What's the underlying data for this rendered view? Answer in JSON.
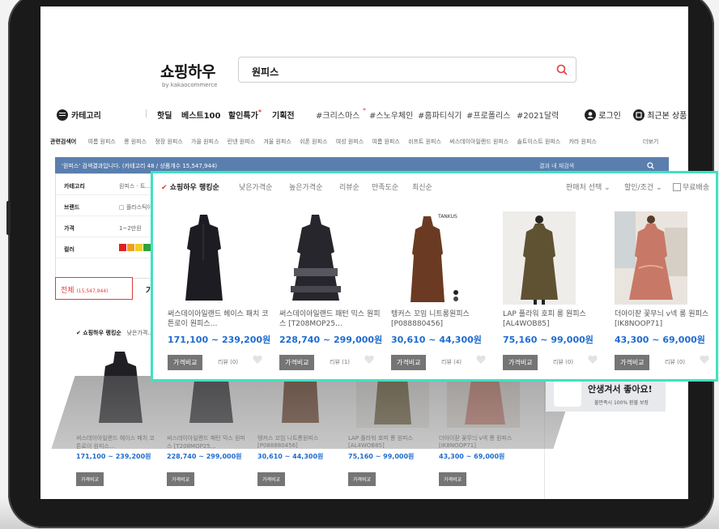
{
  "logo": {
    "title": "쇼핑하우",
    "sub": "by kakaocommerce"
  },
  "search": {
    "value": "원피스"
  },
  "nav": {
    "category": "카테고리",
    "items": [
      "핫딜",
      "베스트100",
      "할인특가",
      "기획전"
    ],
    "tags": [
      "#크리스마스",
      "#스노우체인",
      "#홈파티식기",
      "#프로폴리스",
      "#2021달력"
    ],
    "login": "로그인",
    "recent": "최근본 상품"
  },
  "related": {
    "label": "관련검색어",
    "keywords": [
      "여름 원피스",
      "롱 원피스",
      "정장 원피스",
      "가을 원피스",
      "린넨 원피스",
      "겨울 원피스",
      "쉬폰 원피스",
      "여성 원피스",
      "여름 원피스",
      "쉬프트 원피스",
      "써스데이아일랜드 원피스",
      "솔트이스트 원피스",
      "카라 원피스"
    ],
    "more": "더보기"
  },
  "infobar": {
    "text": "'원피스' 검색결과입니다. (카테고리 48 / 상품개수 15,547,944)",
    "inner": "결과 내 재검색"
  },
  "filters": [
    {
      "key": "카테고리",
      "val": "원피스 · 트…"
    },
    {
      "key": "브랜드",
      "val": "□ 플라스틱아…"
    },
    {
      "key": "가격",
      "val": "1~2만원"
    },
    {
      "key": "컬러",
      "val": ""
    }
  ],
  "colors": {
    "red": "#e02020",
    "orange": "#f0a020",
    "yellow": "#f0d020",
    "green": "#30a040",
    "blue": "#4aa0e0",
    "accent": "#3fe2c2",
    "price": "#1f6ccf"
  },
  "tabs": {
    "all": "전체",
    "all_count": "(15,547,944)",
    "second": "가격"
  },
  "bg_sort": {
    "active": "✔ 쇼핑하우 랭킹순",
    "next": "낮은가격…"
  },
  "sort": {
    "active": "쇼핑하우 랭킹순",
    "options": [
      "낮은가격순",
      "높은가격순",
      "리뷰순",
      "만족도순",
      "최신순"
    ],
    "seller": "판매처 선택",
    "discount": "할인/조건",
    "free_ship": "무료배송"
  },
  "products": [
    {
      "name": "써스데이아일랜드 헤이스 패치 코튼로이 원피스…",
      "price": "171,100 ~ 239,200원",
      "compare": "가격비교",
      "reviews": "리뷰 (0)"
    },
    {
      "name": "써스데이아일랜드 패턴 믹스 원피스 [T208MOP25…",
      "price": "228,740 ~ 299,000원",
      "compare": "가격비교",
      "reviews": "리뷰 (1)"
    },
    {
      "name": "텡커스 꼬임 니트롱원피스 [P088880456]",
      "price": "30,610 ~ 44,300원",
      "compare": "가격비교",
      "reviews": "리뷰 (4)"
    },
    {
      "name": "LAP 플라워 호피 롱 원피스 [AL4WOB85]",
      "price": "75,160 ~ 99,000원",
      "compare": "가격비교",
      "reviews": "리뷰 (0)"
    },
    {
      "name": "더아이잗 꽃무늬 v넥 롱 원피스 [IK8NOOP71]",
      "price": "43,300 ~ 69,000원",
      "compare": "가격비교",
      "reviews": "리뷰 (0)"
    }
  ],
  "brand_label": "TANKUS",
  "ad": {
    "title": "안생겨서 좋아요!",
    "sub": "불만족시 100% 환불 보장"
  }
}
